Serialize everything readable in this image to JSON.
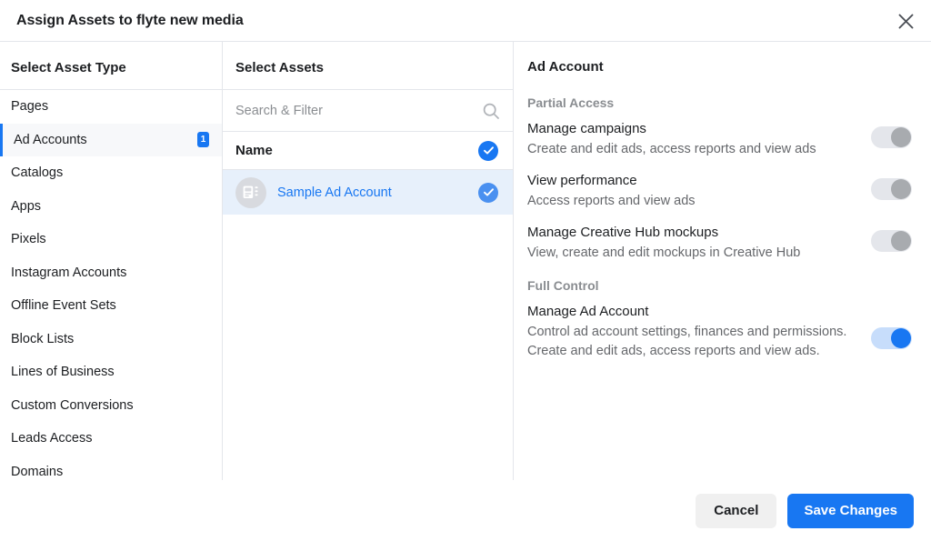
{
  "header": {
    "title": "Assign Assets to flyte new media",
    "close_icon": "close-icon"
  },
  "asset_type_panel": {
    "heading": "Select Asset Type",
    "items": [
      {
        "label": "Pages",
        "badge": "",
        "selected": false
      },
      {
        "label": "Ad Accounts",
        "badge": "1",
        "selected": true
      },
      {
        "label": "Catalogs",
        "badge": "",
        "selected": false
      },
      {
        "label": "Apps",
        "badge": "",
        "selected": false
      },
      {
        "label": "Pixels",
        "badge": "",
        "selected": false
      },
      {
        "label": "Instagram Accounts",
        "badge": "",
        "selected": false
      },
      {
        "label": "Offline Event Sets",
        "badge": "",
        "selected": false
      },
      {
        "label": "Block Lists",
        "badge": "",
        "selected": false
      },
      {
        "label": "Lines of Business",
        "badge": "",
        "selected": false
      },
      {
        "label": "Custom Conversions",
        "badge": "",
        "selected": false
      },
      {
        "label": "Leads Access",
        "badge": "",
        "selected": false
      },
      {
        "label": "Domains",
        "badge": "",
        "selected": false
      }
    ]
  },
  "assets_panel": {
    "heading": "Select Assets",
    "search": {
      "placeholder": "Search & Filter",
      "value": "",
      "icon": "search-icon"
    },
    "column_header": "Name",
    "header_checked": true,
    "rows": [
      {
        "name": "Sample Ad Account",
        "selected": true,
        "checked": true,
        "avatar_icon": "ad-account-icon"
      }
    ]
  },
  "permissions_panel": {
    "heading": "Ad Account",
    "sections": [
      {
        "title": "Partial Access",
        "items": [
          {
            "name": "Manage campaigns",
            "description": "Create and edit ads, access reports and view ads",
            "enabled": false
          },
          {
            "name": "View performance",
            "description": "Access reports and view ads",
            "enabled": false
          },
          {
            "name": "Manage Creative Hub mockups",
            "description": "View, create and edit mockups in Creative Hub",
            "enabled": false
          }
        ]
      },
      {
        "title": "Full Control",
        "items": [
          {
            "name": "Manage Ad Account",
            "description": "Control ad account settings, finances and permissions. Create and edit ads, access reports and view ads.",
            "enabled": true
          }
        ]
      }
    ]
  },
  "footer": {
    "cancel_label": "Cancel",
    "save_label": "Save Changes"
  },
  "colors": {
    "accent": "#1877f2",
    "selected_row_bg": "#e7f0fb",
    "toggle_off_track": "#e4e6eb",
    "toggle_off_knob": "#a8abaf",
    "toggle_on_track": "#c7ddfb"
  }
}
